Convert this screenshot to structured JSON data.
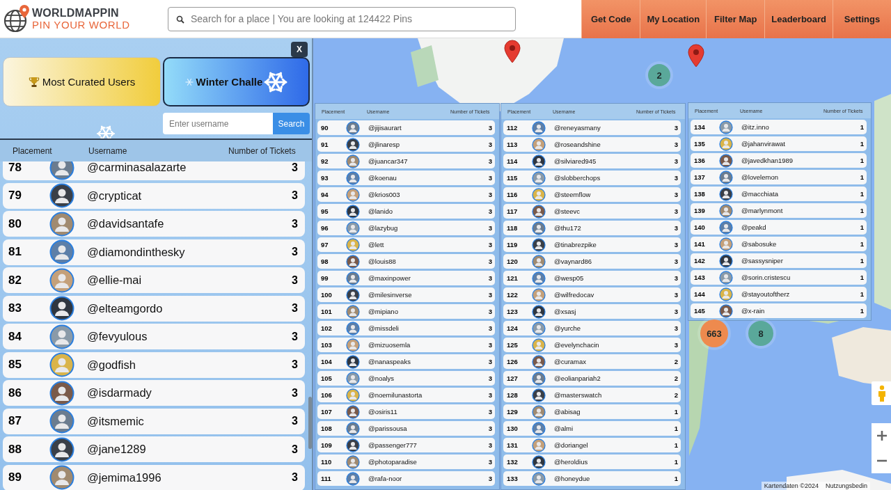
{
  "header": {
    "logo": {
      "title": "WORLDMAPPIN",
      "tagline": "PIN YOUR WORLD"
    },
    "search": {
      "placeholder": "Search for a place | You are looking at 124422 Pins"
    },
    "nav": [
      "Get Code",
      "My Location",
      "Filter Map",
      "Leaderboard",
      "Settings"
    ]
  },
  "panel": {
    "close": "X",
    "tabs": [
      {
        "label": "Most Curated Users",
        "selected": false
      },
      {
        "label": "Winter Challe",
        "selected": true
      }
    ],
    "user_search": {
      "placeholder": "Enter username",
      "button": "Search"
    },
    "columns": [
      "Placement",
      "Username",
      "Number of Tickets"
    ],
    "rows": [
      {
        "placement": "78",
        "username": "@carminasalazarte",
        "tickets": "3"
      },
      {
        "placement": "79",
        "username": "@crypticat",
        "tickets": "3"
      },
      {
        "placement": "80",
        "username": "@davidsantafe",
        "tickets": "3"
      },
      {
        "placement": "81",
        "username": "@diamondinthesky",
        "tickets": "3"
      },
      {
        "placement": "82",
        "username": "@ellie-mai",
        "tickets": "3"
      },
      {
        "placement": "83",
        "username": "@elteamgordo",
        "tickets": "3"
      },
      {
        "placement": "84",
        "username": "@fevyulous",
        "tickets": "3"
      },
      {
        "placement": "85",
        "username": "@godfish",
        "tickets": "3"
      },
      {
        "placement": "86",
        "username": "@isdarmady",
        "tickets": "3"
      },
      {
        "placement": "87",
        "username": "@itsmemic",
        "tickets": "3"
      },
      {
        "placement": "88",
        "username": "@jane1289",
        "tickets": "3"
      },
      {
        "placement": "89",
        "username": "@jemima1996",
        "tickets": "3"
      }
    ]
  },
  "map": {
    "clusters": [
      {
        "count": "2",
        "color": "#5aa89a"
      },
      {
        "count": "663",
        "color": "#ee8a4e"
      },
      {
        "count": "8",
        "color": "#5aa89a"
      }
    ],
    "attribution": [
      "Kartendaten ©2024",
      "Nutzungsbedin"
    ]
  },
  "overlay_tables": [
    {
      "columns": [
        "Placement",
        "Username",
        "Number of Tickets"
      ],
      "rows": [
        {
          "placement": "90",
          "username": "@jijisaurart",
          "tickets": "3"
        },
        {
          "placement": "91",
          "username": "@jlinaresp",
          "tickets": "3"
        },
        {
          "placement": "92",
          "username": "@juancar347",
          "tickets": "3"
        },
        {
          "placement": "93",
          "username": "@koenau",
          "tickets": "3"
        },
        {
          "placement": "94",
          "username": "@krios003",
          "tickets": "3"
        },
        {
          "placement": "95",
          "username": "@lanido",
          "tickets": "3"
        },
        {
          "placement": "96",
          "username": "@lazybug",
          "tickets": "3"
        },
        {
          "placement": "97",
          "username": "@lett",
          "tickets": "3"
        },
        {
          "placement": "98",
          "username": "@louis88",
          "tickets": "3"
        },
        {
          "placement": "99",
          "username": "@maxinpower",
          "tickets": "3"
        },
        {
          "placement": "100",
          "username": "@milesinverse",
          "tickets": "3"
        },
        {
          "placement": "101",
          "username": "@mipiano",
          "tickets": "3"
        },
        {
          "placement": "102",
          "username": "@missdeli",
          "tickets": "3"
        },
        {
          "placement": "103",
          "username": "@mizuosemla",
          "tickets": "3"
        },
        {
          "placement": "104",
          "username": "@nanaspeaks",
          "tickets": "3"
        },
        {
          "placement": "105",
          "username": "@noalys",
          "tickets": "3"
        },
        {
          "placement": "106",
          "username": "@noemilunastorta",
          "tickets": "3"
        },
        {
          "placement": "107",
          "username": "@osiris11",
          "tickets": "3"
        },
        {
          "placement": "108",
          "username": "@parissousa",
          "tickets": "3"
        },
        {
          "placement": "109",
          "username": "@passenger777",
          "tickets": "3"
        },
        {
          "placement": "110",
          "username": "@photoparadise",
          "tickets": "3"
        },
        {
          "placement": "111",
          "username": "@rafa-noor",
          "tickets": "3"
        }
      ]
    },
    {
      "columns": [
        "Placement",
        "Username",
        "Number of Tickets"
      ],
      "rows": [
        {
          "placement": "112",
          "username": "@reneyasmany",
          "tickets": "3"
        },
        {
          "placement": "113",
          "username": "@roseandshine",
          "tickets": "3"
        },
        {
          "placement": "114",
          "username": "@silviared945",
          "tickets": "3"
        },
        {
          "placement": "115",
          "username": "@slobberchops",
          "tickets": "3"
        },
        {
          "placement": "116",
          "username": "@steemflow",
          "tickets": "3"
        },
        {
          "placement": "117",
          "username": "@steevc",
          "tickets": "3"
        },
        {
          "placement": "118",
          "username": "@thu172",
          "tickets": "3"
        },
        {
          "placement": "119",
          "username": "@tinabrezpike",
          "tickets": "3"
        },
        {
          "placement": "120",
          "username": "@vaynard86",
          "tickets": "3"
        },
        {
          "placement": "121",
          "username": "@wesp05",
          "tickets": "3"
        },
        {
          "placement": "122",
          "username": "@wilfredocav",
          "tickets": "3"
        },
        {
          "placement": "123",
          "username": "@xsasj",
          "tickets": "3"
        },
        {
          "placement": "124",
          "username": "@yurche",
          "tickets": "3"
        },
        {
          "placement": "125",
          "username": "@evelynchacin",
          "tickets": "3"
        },
        {
          "placement": "126",
          "username": "@curamax",
          "tickets": "2"
        },
        {
          "placement": "127",
          "username": "@eolianpariah2",
          "tickets": "2"
        },
        {
          "placement": "128",
          "username": "@masterswatch",
          "tickets": "2"
        },
        {
          "placement": "129",
          "username": "@abisag",
          "tickets": "1"
        },
        {
          "placement": "130",
          "username": "@almi",
          "tickets": "1"
        },
        {
          "placement": "131",
          "username": "@doriangel",
          "tickets": "1"
        },
        {
          "placement": "132",
          "username": "@heroldius",
          "tickets": "1"
        },
        {
          "placement": "133",
          "username": "@honeydue",
          "tickets": "1"
        }
      ]
    },
    {
      "columns": [
        "Placement",
        "Username",
        "Number of Tickets"
      ],
      "rows": [
        {
          "placement": "134",
          "username": "@itz.inno",
          "tickets": "1"
        },
        {
          "placement": "135",
          "username": "@jahanvirawat",
          "tickets": "1"
        },
        {
          "placement": "136",
          "username": "@javedkhan1989",
          "tickets": "1"
        },
        {
          "placement": "137",
          "username": "@lovelemon",
          "tickets": "1"
        },
        {
          "placement": "138",
          "username": "@macchiata",
          "tickets": "1"
        },
        {
          "placement": "139",
          "username": "@marlynmont",
          "tickets": "1"
        },
        {
          "placement": "140",
          "username": "@peakd",
          "tickets": "1"
        },
        {
          "placement": "141",
          "username": "@sabosuke",
          "tickets": "1"
        },
        {
          "placement": "142",
          "username": "@sassysniper",
          "tickets": "1"
        },
        {
          "placement": "143",
          "username": "@sorin.cristescu",
          "tickets": "1"
        },
        {
          "placement": "144",
          "username": "@stayoutoftherz",
          "tickets": "1"
        },
        {
          "placement": "145",
          "username": "@x-rain",
          "tickets": "1"
        }
      ]
    }
  ]
}
